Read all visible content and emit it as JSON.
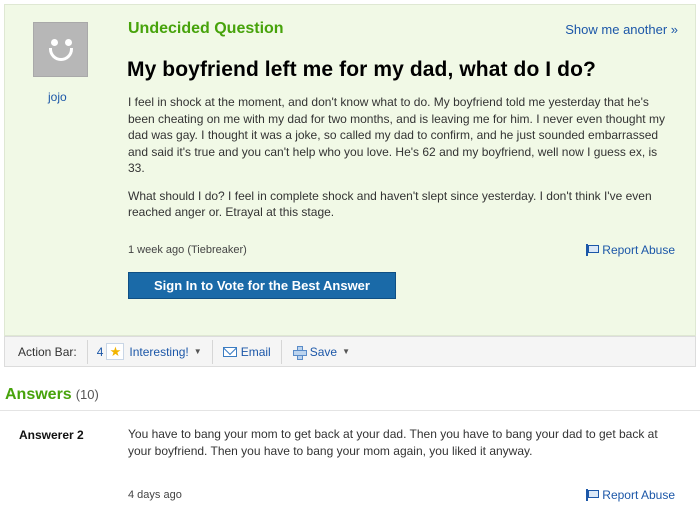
{
  "question": {
    "label": "Undecided Question",
    "show_another": "Show me another »",
    "title": "My boyfriend left me for my dad, what do I do?",
    "asker": "jojo",
    "body": [
      "I feel in shock at the moment, and don't know what to do. My boyfriend told me yesterday that he's been cheating on me with my dad for two months, and is leaving me for him. I never even thought my dad was gay. I thought it was a joke, so called my dad to confirm, and he just sounded embarrassed and said it's true and you can't help who you love. He's 62 and my boyfriend, well now I guess ex, is 33.",
      "What should I do? I feel in complete shock and haven't slept since yesterday. I don't think I've even reached anger or. Etrayal at this stage."
    ],
    "meta": "1 week ago (Tiebreaker)",
    "report_label": "Report Abuse",
    "vote_button": "Sign In to Vote for the Best Answer"
  },
  "action_bar": {
    "label": "Action Bar:",
    "interesting_count": "4",
    "interesting_label": "Interesting!",
    "email_label": "Email",
    "save_label": "Save"
  },
  "answers": {
    "title": "Answers",
    "count": "(10)",
    "items": [
      {
        "answerer": "Answerer 2",
        "body": "You have to bang your mom to get back at your dad. Then you have to bang your dad to get back at your boyfriend. Then you have to bang your mom again, you liked it anyway.",
        "time": "4 days ago",
        "report_label": "Report Abuse"
      }
    ]
  },
  "colors": {
    "accent_green": "#47a30b",
    "link_blue": "#1c57a8",
    "button_blue": "#1a6aa8",
    "question_bg": "#f1f9e6"
  },
  "icons": [
    "smiley-avatar-icon",
    "flag-icon",
    "star-icon",
    "chevron-down-icon",
    "mail-icon",
    "plus-icon"
  ]
}
